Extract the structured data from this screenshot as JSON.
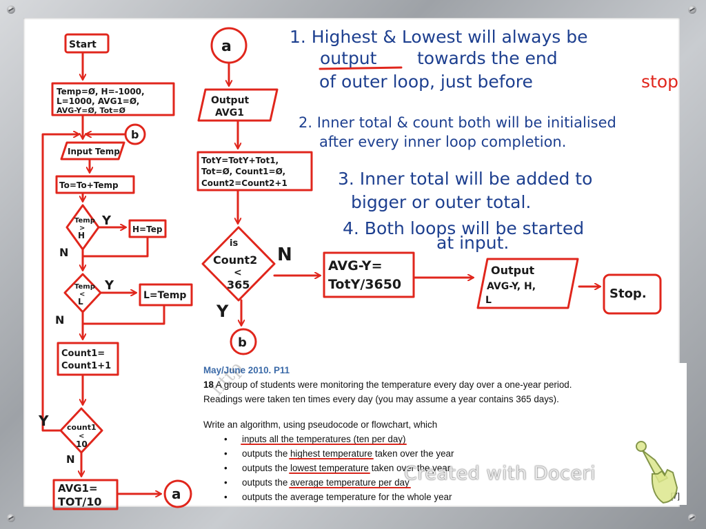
{
  "flowchart_left": {
    "start": "Start",
    "init": [
      "Temp=Ø, H=-1000,",
      "L=1000, AVG1=Ø,",
      "AVG-Y=Ø, Tot=Ø"
    ],
    "connector_b_in": "b",
    "input": "Input Temp",
    "total": "To=To+Temp",
    "decision_high": [
      "Temp",
      ">",
      "H"
    ],
    "assign_high": "H=Tep",
    "decision_low": [
      "Temp",
      "<",
      "L"
    ],
    "assign_low": "L=Temp",
    "count_inc": [
      "Count1=",
      "Count1+1"
    ],
    "decision_count1": [
      "count1",
      "<",
      "10"
    ],
    "avg1": [
      "AVG1=",
      "TOT/10"
    ],
    "connector_a_out": "a",
    "label_y": "Y",
    "label_n": "N"
  },
  "flowchart_right": {
    "connector_a_in": "a",
    "output_avg1": [
      "Output",
      "AVG1"
    ],
    "accum": [
      "TotY=TotY+Tot1,",
      "Tot=Ø, Count1=Ø,",
      "Count2=Count2+1"
    ],
    "decision_count2": [
      "is",
      "Count2",
      "<",
      "365"
    ],
    "connector_b_out": "b",
    "avg_y": [
      "AVG-Y=",
      "TotY/3650"
    ],
    "output_final": [
      "Output",
      "AVG-Y, H,",
      "L"
    ],
    "stop": "Stop.",
    "label_y": "Y",
    "label_n": "N"
  },
  "notes": {
    "n1_line1": "1. Highest & Lowest will always be",
    "n1_line2a": "output",
    "n1_line2b": "towards the end",
    "n1_line3a": "of outer loop, just before",
    "n1_line3b": "stop",
    "n2_line1": "2. Inner total & count both will be initialised",
    "n2_line2": "after every inner loop completion.",
    "n3_line1": "3. Inner total will be added to",
    "n3_line2": "bigger or outer total.",
    "n4_line1": "4. Both loops will be started",
    "n4_line2": "at input."
  },
  "question": {
    "heading": "May/June 2010. P11",
    "number": "18",
    "line1": "A group of students were monitoring the temperature every day over a one-year period.",
    "line2": "Readings were taken ten times every day (you may assume a year contains 365 days).",
    "line3": "Write an algorithm, using pseudocode or flowchart, which",
    "bullets": [
      {
        "pre": "",
        "hl": "inputs all the temperatures (ten per day)",
        "post": ""
      },
      {
        "pre": "outputs the ",
        "hl": "highest temperature",
        "post": " taken over the year"
      },
      {
        "pre": "outputs the ",
        "hl": "lowest temperature",
        "post": " taken over the year"
      },
      {
        "pre": "outputs the ",
        "hl": "average temperature per day",
        "post": ""
      },
      {
        "pre": "outputs the average temperature for the whole year",
        "hl": "",
        "post": ""
      }
    ],
    "marks": "[7]"
  },
  "watermark": "Created with Doceri",
  "overlay_text": "http",
  "colors": {
    "ink": "#1a1a1a",
    "red": "#e0261c",
    "blue": "#1d3f8f",
    "heading": "#3b6aa8"
  }
}
